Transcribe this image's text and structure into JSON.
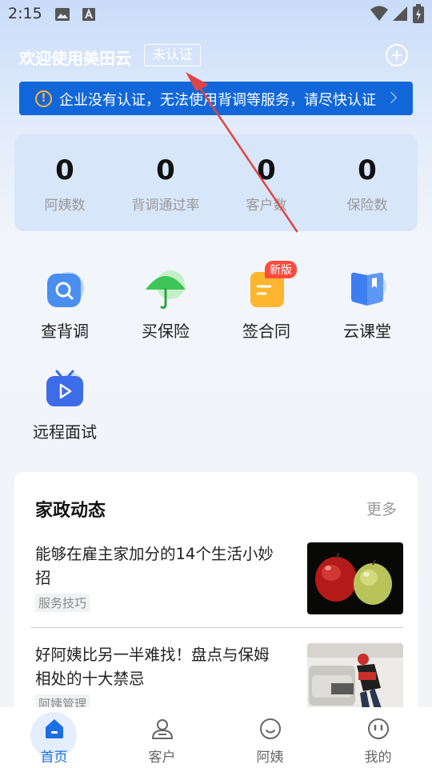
{
  "status_bar": {
    "time": "2:15",
    "icons": [
      "photo-icon",
      "font-icon",
      "wifi-icon",
      "signal-icon",
      "battery-icon"
    ]
  },
  "header": {
    "welcome": "欢迎使用美田云",
    "cert_status": "未认证",
    "add_icon": "plus-circle-icon"
  },
  "notice": {
    "icon": "warning-circle-icon",
    "icon_glyph": "!",
    "text": "企业没有认证，无法使用背调等服务，请尽快认证"
  },
  "stats": [
    {
      "value": "0",
      "label": "阿姨数"
    },
    {
      "value": "0",
      "label": "背调通过率"
    },
    {
      "value": "0",
      "label": "客户数"
    },
    {
      "value": "0",
      "label": "保险数"
    }
  ],
  "features": [
    {
      "label": "查背调",
      "icon": "search-check-icon"
    },
    {
      "label": "买保险",
      "icon": "umbrella-icon"
    },
    {
      "label": "签合同",
      "icon": "contract-icon",
      "badge": "新版"
    },
    {
      "label": "云课堂",
      "icon": "book-icon"
    },
    {
      "label": "远程面试",
      "icon": "video-tv-icon"
    }
  ],
  "news": {
    "title": "家政动态",
    "more": "更多",
    "items": [
      {
        "title": "能够在雇主家加分的14个生活小妙招",
        "tag": "服务技巧",
        "thumb": "apples-photo"
      },
      {
        "title": "好阿姨比另一半难找！盘点与保姆相处的十大禁忌",
        "tag": "阿姨管理",
        "thumb": "housekeeping-photo"
      }
    ]
  },
  "tabs": [
    {
      "label": "首页",
      "icon": "home-icon",
      "active": true
    },
    {
      "label": "客户",
      "icon": "user-icon",
      "active": false
    },
    {
      "label": "阿姨",
      "icon": "smile-icon",
      "active": false
    },
    {
      "label": "我的",
      "icon": "more-dots-icon",
      "active": false
    }
  ],
  "colors": {
    "accent": "#1a6fe4",
    "notice_bg": "#1167d9",
    "warning": "#ffb43a",
    "badge_red": "#ff4a3d",
    "annotation_arrow": "#e04545"
  }
}
